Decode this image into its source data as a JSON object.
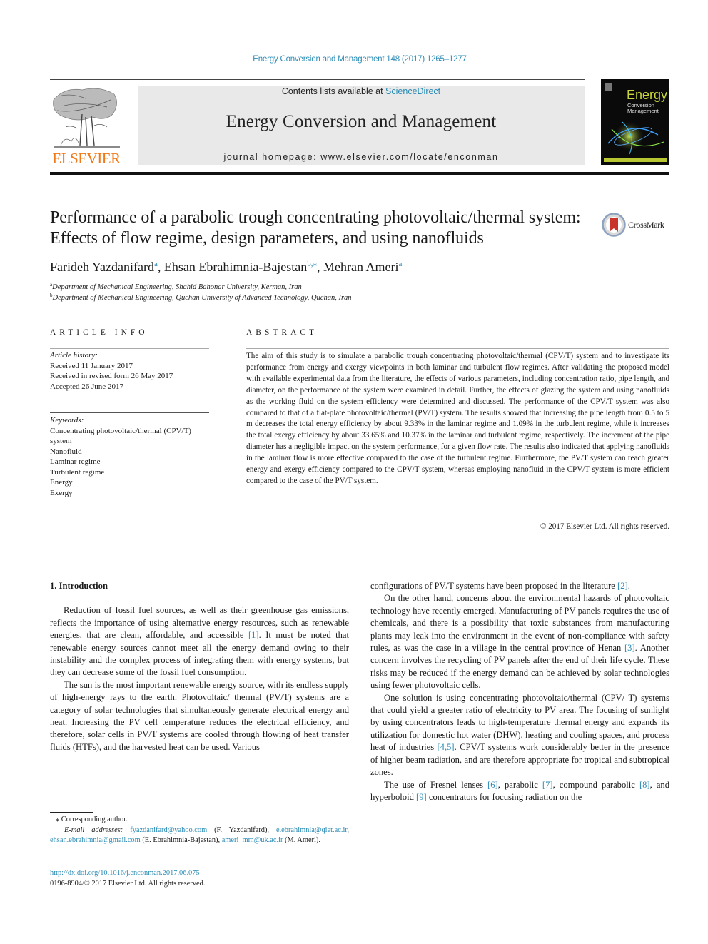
{
  "header": {
    "journal_reference": "Energy Conversion and Management 148 (2017) 1265–1277",
    "contents_prefix": "Contents lists available at ",
    "contents_link": "ScienceDirect",
    "journal_title": "Energy Conversion and Management",
    "homepage_prefix": "journal homepage: ",
    "homepage_url": "www.elsevier.com/locate/enconman",
    "publisher_logo": "ELSEVIER",
    "cover": {
      "title": "Energy",
      "subtitle_1": "Conversion",
      "subtitle_2": "Management"
    },
    "colors": {
      "link": "#2a8bb5",
      "elsevier_orange": "#f07a1a",
      "masthead_bg": "#e9e9e9"
    }
  },
  "article": {
    "title": "Performance of a parabolic trough concentrating photovoltaic/thermal system: Effects of flow regime, design parameters, and using nanofluids",
    "crossmark_label": "CrossMark",
    "authors": [
      {
        "name": "Farideh Yazdanifard",
        "sup": "a"
      },
      {
        "name": "Ehsan Ebrahimnia-Bajestan",
        "sup": "b,⁎"
      },
      {
        "name": "Mehran Ameri",
        "sup": "a"
      }
    ],
    "affiliations": [
      {
        "mark": "a",
        "text": "Department of Mechanical Engineering, Shahid Bahonar University, Kerman, Iran"
      },
      {
        "mark": "b",
        "text": "Department of Mechanical Engineering, Quchan University of Advanced Technology, Quchan, Iran"
      }
    ]
  },
  "article_info": {
    "heading": "ARTICLE INFO",
    "history_label": "Article history:",
    "history": [
      "Received 11 January 2017",
      "Received in revised form 26 May 2017",
      "Accepted 26 June 2017"
    ],
    "keywords_label": "Keywords:",
    "keywords": [
      "Concentrating photovoltaic/thermal (CPV/T) system",
      "Nanofluid",
      "Laminar regime",
      "Turbulent regime",
      "Energy",
      "Exergy"
    ]
  },
  "abstract": {
    "heading": "ABSTRACT",
    "text": "The aim of this study is to simulate a parabolic trough concentrating photovoltaic/thermal (CPV/T) sys­tem and to investigate its performance from energy and exergy viewpoints in both laminar and turbulent flow regimes. After validating the proposed model with available experimental data from the literature, the effects of various parameters, including concentration ratio, pipe length, and diameter, on the perfor­mance of the system were examined in detail. Further, the effects of glazing the system and using nanofluids as the working fluid on the system efficiency were determined and discussed. The perfor­mance of the CPV/T system was also compared to that of a flat-plate photovoltaic/thermal (PV/T) system. The results showed that increasing the pipe length from 0.5 to 5 m decreases the total energy efficiency by about 9.33% in the laminar regime and 1.09% in the turbulent regime, while it increases the total exergy efficiency by about 33.65% and 10.37% in the laminar and turbulent regime, respectively. The increment of the pipe diameter has a negligible impact on the system performance, for a given flow rate. The results also indicated that applying nanofluids in the laminar flow is more effective compared to the case of the turbulent regime. Furthermore, the PV/T system can reach greater energy and exergy effi­ciency compared to the CPV/T system, whereas employing nanofluid in the CPV/T system is more efficient compared to the case of the PV/T system.",
    "copyright": "© 2017 Elsevier Ltd. All rights reserved."
  },
  "body": {
    "section_heading": "1. Introduction",
    "left_paragraphs": [
      {
        "parts": [
          {
            "t": "Reduction of fossil fuel sources, as well as their greenhouse gas emissions, reflects the importance of using alternative energy resources, such as renewable energies, that are clean, affordable, and accessible "
          },
          {
            "t": "[1]",
            "link": true
          },
          {
            "t": ". It must be noted that renewable energy sources cannot meet all the energy demand owing to their instability and the complex process of integrating them with energy systems, but they can decrease some of the fossil fuel consumption."
          }
        ]
      },
      {
        "parts": [
          {
            "t": "The sun is the most important renewable energy source, with its endless supply of high-energy rays to the earth. Photovoltaic/ thermal (PV/T) systems are a category of solar technologies that simultaneously generate electrical energy and heat. Increasing the PV cell temperature reduces the electrical efficiency, and there­fore, solar cells in PV/T systems are cooled through flowing of heat transfer fluids (HTFs), and the harvested heat can be used. Various"
          }
        ]
      }
    ],
    "right_paragraphs": [
      {
        "noindent": true,
        "parts": [
          {
            "t": "configurations of PV/T systems have been proposed in the litera­ture "
          },
          {
            "t": "[2]",
            "link": true
          },
          {
            "t": "."
          }
        ]
      },
      {
        "parts": [
          {
            "t": "On the other hand, concerns about the environmental hazards of photovoltaic technology have recently emerged. Manufacturing of PV panels requires the use of chemicals, and there is a possibility that toxic substances from manufacturing plants may leak into the environment in the event of non-compliance with safety rules, as was the case in a village in the central province of Henan "
          },
          {
            "t": "[3]",
            "link": true
          },
          {
            "t": ". Another concern involves the recycling of PV panels after the end of their life cycle. These risks may be reduced if the energy demand can be achieved by solar technologies using fewer photovoltaic cells."
          }
        ]
      },
      {
        "parts": [
          {
            "t": "One solution is using concentrating photovoltaic/thermal (CPV/ T) systems that could yield a greater ratio of electricity to PV area. The focusing of sunlight by using concentrators leads to high-temperature thermal energy and expands its utilization for domes­tic hot water (DHW), heating and cooling spaces, and process heat of industries "
          },
          {
            "t": "[4,5]",
            "link": true
          },
          {
            "t": ". CPV/T systems work considerably better in the presence of higher beam radiation, and are therefore appropriate for tropical and subtropical zones."
          }
        ]
      },
      {
        "parts": [
          {
            "t": "The use of Fresnel lenses "
          },
          {
            "t": "[6]",
            "link": true
          },
          {
            "t": ", parabolic "
          },
          {
            "t": "[7]",
            "link": true
          },
          {
            "t": ", compound parabolic "
          },
          {
            "t": "[8]",
            "link": true
          },
          {
            "t": ", and hyperboloid "
          },
          {
            "t": "[9]",
            "link": true
          },
          {
            "t": " concentrators for focusing radiation on the"
          }
        ]
      }
    ]
  },
  "footnotes": {
    "corresponding": "⁎ Corresponding author.",
    "email_label": "E-mail addresses:",
    "emails": [
      {
        "email": "fyazdanifard@yahoo.com",
        "who": " (F. Yazdanifard), "
      },
      {
        "email": "e.ebrahimnia@qiet.ac.ir",
        "who": ", "
      },
      {
        "email": "ehsan.ebrahimnia@gmail.com",
        "who": " (E. Ebrahimnia-Bajestan), "
      },
      {
        "email": "ameri_mm@uk.ac.ir",
        "who": " (M. Ameri)."
      }
    ],
    "doi": "http://dx.doi.org/10.1016/j.enconman.2017.06.075",
    "issn_copyright": "0196-8904/© 2017 Elsevier Ltd. All rights reserved."
  }
}
